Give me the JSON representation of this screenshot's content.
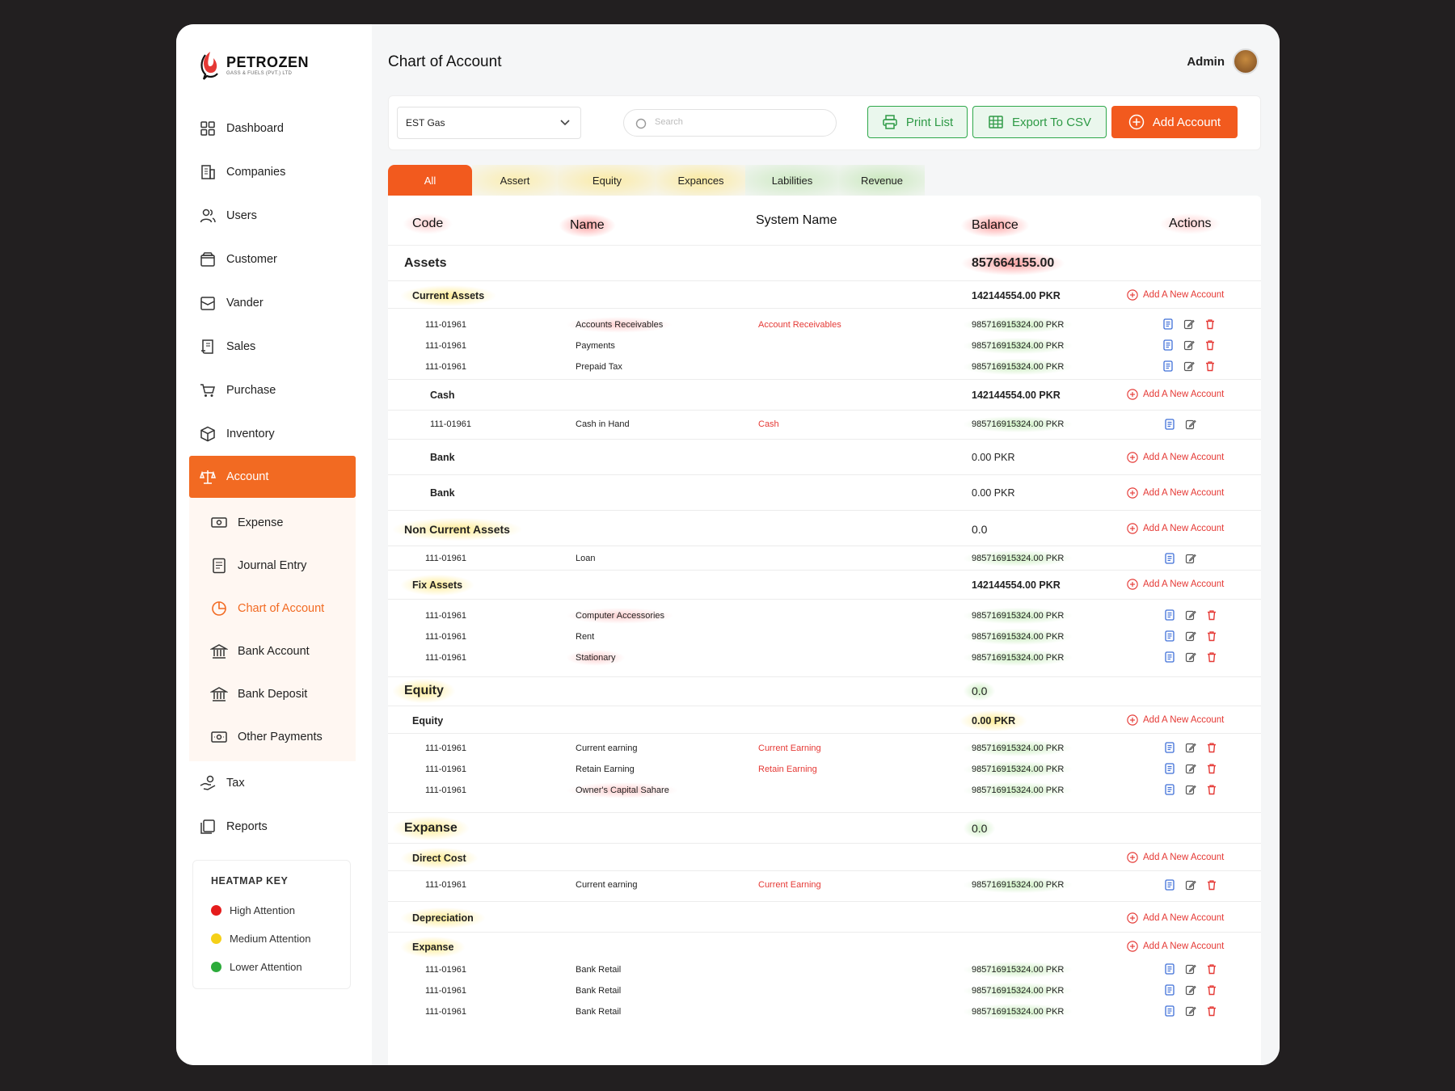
{
  "brand": {
    "name": "PETROZEN",
    "tagline": "GASS & FUELS (PVT.) LTD"
  },
  "colors": {
    "accent": "#f26a22",
    "green": "#2ea84a",
    "red": "#e53935"
  },
  "nav": {
    "dashboard": "Dashboard",
    "companies": "Companies",
    "users": "Users",
    "customer": "Customer",
    "vander": "Vander",
    "sales": "Sales",
    "purchase": "Purchase",
    "inventory": "Inventory",
    "account": "Account",
    "expense": "Expense",
    "journal": "Journal Entry",
    "chart": "Chart of Account",
    "bank_account": "Bank Account",
    "bank_deposit": "Bank Deposit",
    "other_payments": "Other Payments",
    "tax": "Tax",
    "reports": "Reports"
  },
  "heatmap_key": {
    "title": "HEATMAP KEY",
    "high": "High Attention",
    "medium": "Medium Attention",
    "low": "Lower Attention"
  },
  "header": {
    "title": "Chart of Account",
    "user": "Admin"
  },
  "toolbar": {
    "company": "EST Gas",
    "search_placeholder": "Search",
    "print": "Print List",
    "export": "Export To CSV",
    "add": "Add Account"
  },
  "tabs": [
    "All",
    "Assert",
    "Equity",
    "Expances",
    "Labilities",
    "Revenue"
  ],
  "columns": {
    "code": "Code",
    "name": "Name",
    "system": "System Name",
    "balance": "Balance",
    "actions": "Actions"
  },
  "add_new_label": "Add A New Account",
  "sections": {
    "assets": {
      "title": "Assets",
      "balance": "857664155.00"
    },
    "current_assets": {
      "title": "Current Assets",
      "balance": "142144554.00 PKR"
    },
    "cash": {
      "title": "Cash",
      "balance": "142144554.00 PKR"
    },
    "bank1": {
      "title": "Bank",
      "balance": "0.00 PKR"
    },
    "bank2": {
      "title": "Bank",
      "balance": "0.00 PKR"
    },
    "non_current": {
      "title": "Non Current Assets",
      "balance": "0.0"
    },
    "fix_assets": {
      "title": "Fix Assets",
      "balance": "142144554.00 PKR"
    },
    "equity": {
      "title": "Equity",
      "balance": "0.0"
    },
    "equity_sub": {
      "title": "Equity",
      "balance": "0.00 PKR"
    },
    "expanse": {
      "title": "Expanse",
      "balance": "0.0"
    },
    "direct_cost": {
      "title": "Direct Cost"
    },
    "depreciation": {
      "title": "Depreciation"
    },
    "expanse_sub": {
      "title": "Expanse"
    }
  },
  "rows": {
    "r1": {
      "code": "111-01961",
      "name": "Accounts Receivables",
      "system": "Account Receivables",
      "balance": "985716915324.00 PKR"
    },
    "r2": {
      "code": "111-01961",
      "name": "Payments",
      "system": "",
      "balance": "985716915324.00 PKR"
    },
    "r3": {
      "code": "111-01961",
      "name": "Prepaid Tax",
      "system": "",
      "balance": "985716915324.00 PKR"
    },
    "r4": {
      "code": "111-01961",
      "name": "Cash in Hand",
      "system": "Cash",
      "balance": "985716915324.00 PKR"
    },
    "r5": {
      "code": "111-01961",
      "name": "Loan",
      "system": "",
      "balance": "985716915324.00 PKR"
    },
    "r6": {
      "code": "111-01961",
      "name": "Computer Accessories",
      "system": "",
      "balance": "985716915324.00 PKR"
    },
    "r7": {
      "code": "111-01961",
      "name": "Rent",
      "system": "",
      "balance": "985716915324.00 PKR"
    },
    "r8": {
      "code": "111-01961",
      "name": "Stationary",
      "system": "",
      "balance": "985716915324.00 PKR"
    },
    "r9": {
      "code": "111-01961",
      "name": "Current earning",
      "system": "Current Earning",
      "balance": "985716915324.00 PKR"
    },
    "r10": {
      "code": "111-01961",
      "name": "Retain Earning",
      "system": "Retain Earning",
      "balance": "985716915324.00 PKR"
    },
    "r11": {
      "code": "111-01961",
      "name": "Owner's Capital Sahare",
      "system": "",
      "balance": "985716915324.00 PKR"
    },
    "r12": {
      "code": "111-01961",
      "name": "Current earning",
      "system": "Current Earning",
      "balance": "985716915324.00 PKR"
    },
    "r13": {
      "code": "111-01961",
      "name": "Bank Retail",
      "system": "",
      "balance": "985716915324.00 PKR"
    },
    "r14": {
      "code": "111-01961",
      "name": "Bank Retail",
      "system": "",
      "balance": "985716915324.00 PKR"
    },
    "r15": {
      "code": "111-01961",
      "name": "Bank Retail",
      "system": "",
      "balance": "985716915324.00 PKR"
    }
  }
}
